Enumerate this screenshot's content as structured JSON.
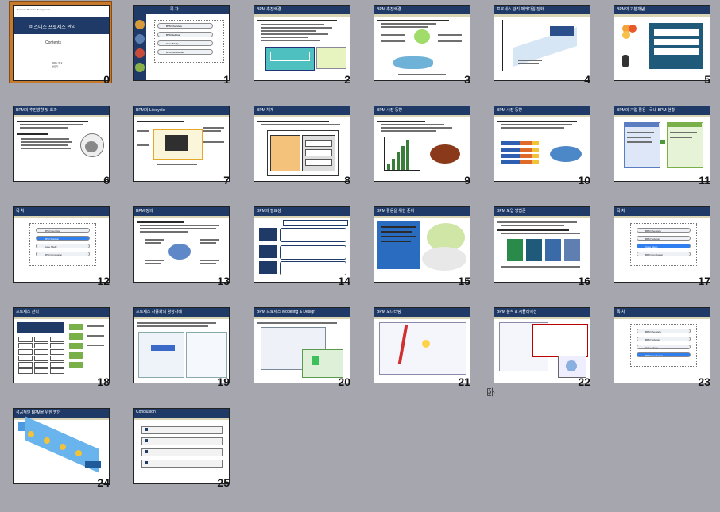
{
  "slides": [
    {
      "num": "0",
      "title": "",
      "selected": true
    },
    {
      "num": "1",
      "title": "목 차"
    },
    {
      "num": "2",
      "title": "BPM 추진배경"
    },
    {
      "num": "3",
      "title": "BPM 추진배경"
    },
    {
      "num": "4",
      "title": "프로세스 관리 패러다임 진화"
    },
    {
      "num": "5",
      "title": "BPM의 기본개념"
    },
    {
      "num": "6",
      "title": "BPM의 추진방향 및 효과"
    },
    {
      "num": "7",
      "title": "BPM의 Lifecycle"
    },
    {
      "num": "8",
      "title": "BPM 체계"
    },
    {
      "num": "9",
      "title": "BPM 시장 동향"
    },
    {
      "num": "10",
      "title": "BPM 시장 동향"
    },
    {
      "num": "11",
      "title": "BPM의 기업 활용 - 국내 BPM 현황"
    },
    {
      "num": "12",
      "title": "목 차"
    },
    {
      "num": "13",
      "title": "BPM 정의"
    },
    {
      "num": "14",
      "title": "BPM의 필요성"
    },
    {
      "num": "15",
      "title": "BPM 활용을 위한 준비"
    },
    {
      "num": "16",
      "title": "BPM 도입 방법론"
    },
    {
      "num": "17",
      "title": "목 차"
    },
    {
      "num": "18",
      "title": "프로세스 관리"
    },
    {
      "num": "19",
      "title": "프로세스 자동화의 향상사례"
    },
    {
      "num": "20",
      "title": "BPM 프로세스 Modeling & Design"
    },
    {
      "num": "21",
      "title": "BPM 모니터링"
    },
    {
      "num": "22",
      "title": "BPM 분석 & 시뮬레이션"
    },
    {
      "num": "23",
      "title": "목 차"
    },
    {
      "num": "24",
      "title": "성공적인 BPM을 위한 방안"
    },
    {
      "num": "25",
      "title": "Conclusion"
    }
  ],
  "cover": {
    "top_line": "Business Process Management",
    "title": "비즈니스 프로세스 관리",
    "subtitle": "Contents",
    "date": "2006. 5. 2",
    "author": "발표자"
  },
  "toc_items": [
    "BPM Overview",
    "BPM Solution",
    "Case Study",
    "BPM Conclusion"
  ],
  "footer_glyph": "卧"
}
